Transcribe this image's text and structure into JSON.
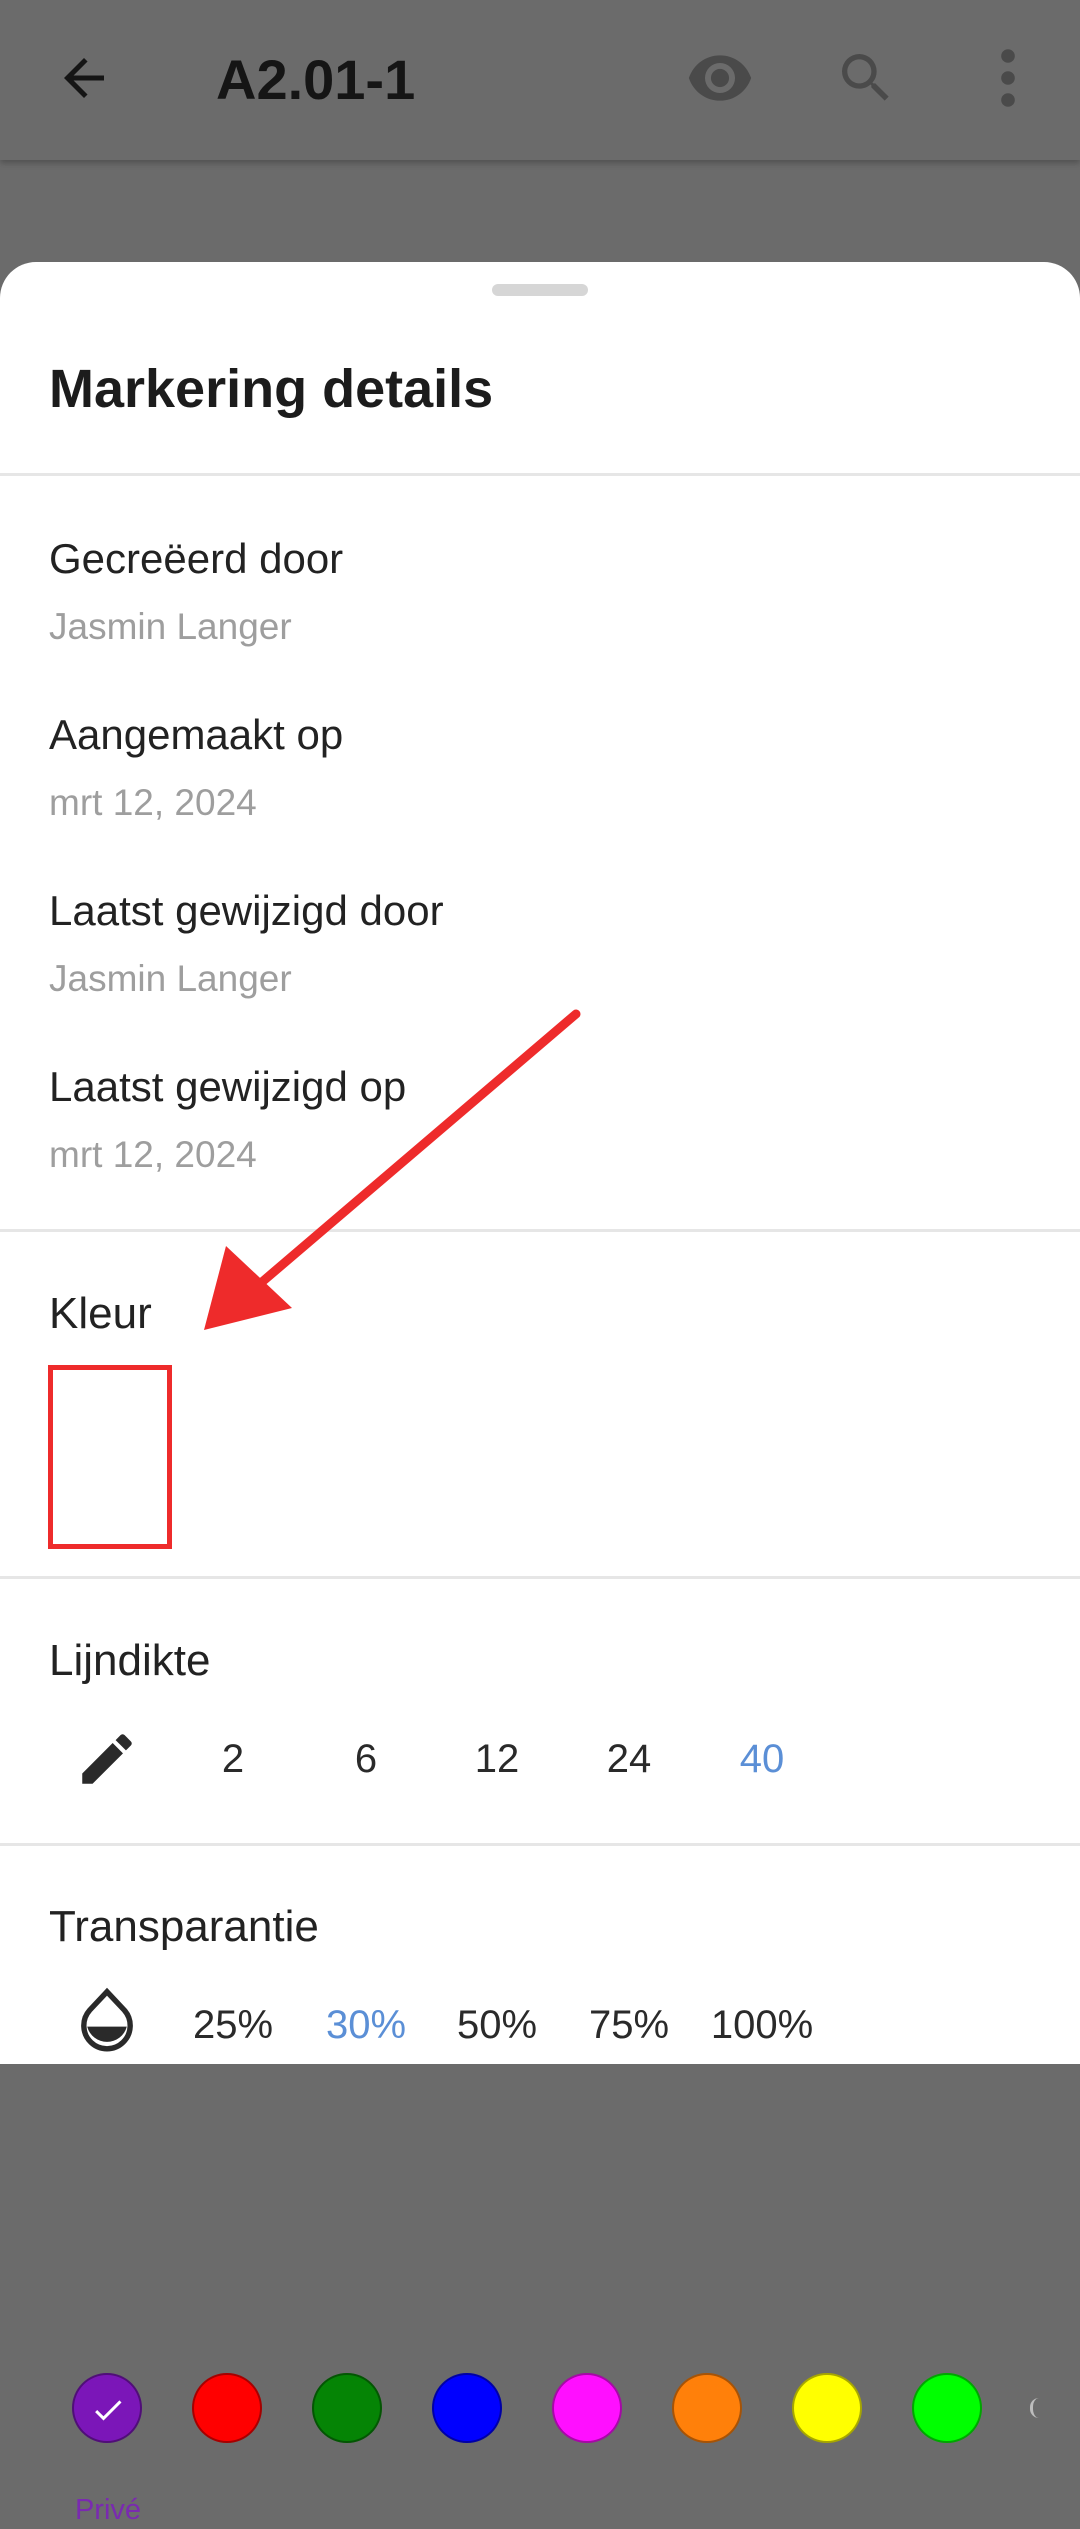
{
  "appbar": {
    "title": "A2.01-1",
    "icons": [
      "arrow-back-icon",
      "eye-icon",
      "search-icon",
      "more-vert-icon"
    ]
  },
  "sheet": {
    "title": "Markering details",
    "info": [
      {
        "label": "Gecreëerd door",
        "value": "Jasmin Langer"
      },
      {
        "label": "Aangemaakt op",
        "value": "mrt 12, 2024"
      },
      {
        "label": "Laatst gewijzigd door",
        "value": "Jasmin Langer"
      },
      {
        "label": "Laatst gewijzigd op",
        "value": "mrt 12, 2024"
      }
    ],
    "color": {
      "label": "Kleur",
      "selected_caption": "Privé",
      "swatches": [
        "#7b16b8",
        "#ff0000",
        "#058405",
        "#0000ff",
        "#ff0fff",
        "#ff800a",
        "#ffff00",
        "#00ff00"
      ]
    },
    "line_width": {
      "label": "Lijndikte",
      "options": [
        "2",
        "6",
        "12",
        "24",
        "40"
      ],
      "selected": "40"
    },
    "transparency": {
      "label": "Transparantie",
      "options": [
        "25%",
        "30%",
        "50%",
        "75%",
        "100%"
      ],
      "selected": "30%"
    }
  },
  "colors": {
    "accent": "#5b8fd6",
    "private": "#7a2ab0",
    "annotation": "#ee2b2b"
  }
}
